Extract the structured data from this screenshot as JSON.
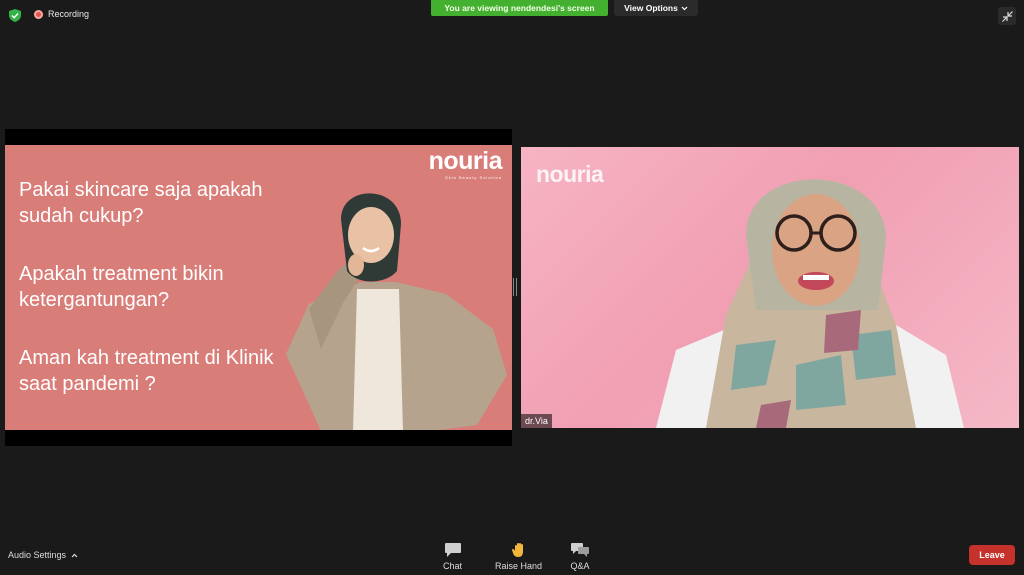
{
  "top": {
    "recording_label": "Recording",
    "viewing_banner": "You are viewing nendendesi's screen",
    "view_options_label": "View Options"
  },
  "slide": {
    "logo": "nouria",
    "logo_sub": "Skin Beauty Solution",
    "questions": [
      "Pakai skincare saja apakah sudah cukup?",
      "Apakah treatment bikin ketergantungan?",
      "Aman kah treatment di Klinik saat pandemi ?"
    ]
  },
  "video": {
    "participant_name": "dr.Via",
    "logo": "nouria"
  },
  "bottom": {
    "audio_settings_label": "Audio Settings",
    "chat_label": "Chat",
    "raise_hand_label": "Raise Hand",
    "qa_label": "Q&A",
    "leave_label": "Leave"
  },
  "colors": {
    "banner_green": "#44b02f",
    "leave_red": "#c4322b",
    "slide_bg": "#d97d79",
    "video_bg": "#f19fb3"
  }
}
